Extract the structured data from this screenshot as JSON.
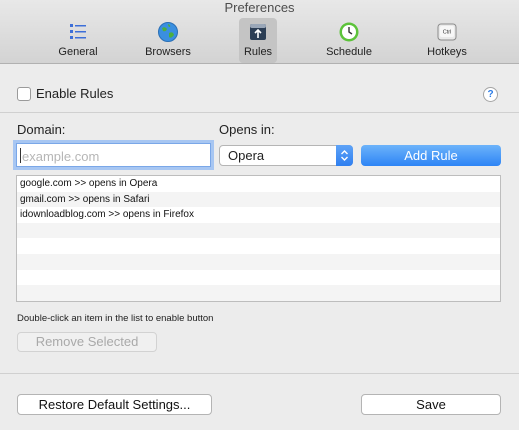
{
  "window": {
    "title": "Preferences"
  },
  "toolbar": {
    "tabs": [
      {
        "label": "General",
        "icon": "list-icon"
      },
      {
        "label": "Browsers",
        "icon": "globe-icon"
      },
      {
        "label": "Rules",
        "icon": "rules-icon",
        "selected": true
      },
      {
        "label": "Schedule",
        "icon": "clock-icon"
      },
      {
        "label": "Hotkeys",
        "icon": "ctrl-key-icon",
        "icon_text": "Ctrl"
      }
    ]
  },
  "rules": {
    "enable_label": "Enable Rules",
    "enable_checked": false,
    "help_label": "?",
    "domain_label": "Domain:",
    "domain_value": "",
    "domain_placeholder": "example.com",
    "opens_in_label": "Opens in:",
    "opens_in_value": "Opera",
    "add_button": "Add Rule",
    "list": [
      "google.com >> opens in Opera",
      "gmail.com >> opens in Safari",
      "idownloadblog.com >> opens in Firefox",
      "",
      "",
      "",
      "",
      ""
    ],
    "hint": "Double-click an item in the list to enable button",
    "remove_button": "Remove Selected"
  },
  "footer": {
    "restore_button": "Restore Default Settings...",
    "save_button": "Save"
  },
  "colors": {
    "accent": "#2d84f5",
    "focus_ring": "#a7c6f2"
  }
}
